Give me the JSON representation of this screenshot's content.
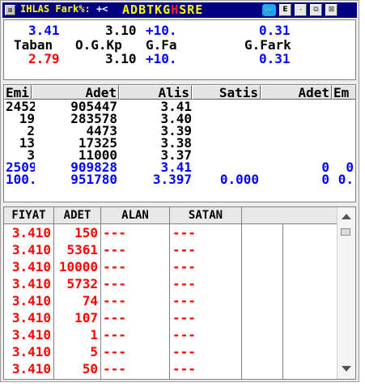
{
  "titlebar": {
    "system_icon": "close-box-icon",
    "name": "IHLAS Fark%:",
    "marker": "+<",
    "letters": [
      {
        "ch": "A",
        "color": "#ffff00"
      },
      {
        "ch": "D",
        "color": "#ffff00"
      },
      {
        "ch": "B",
        "color": "#ffff00"
      },
      {
        "ch": "T",
        "color": "#ffff00"
      },
      {
        "ch": "K",
        "color": "#ffff00"
      },
      {
        "ch": "G",
        "color": "#ffff00"
      },
      {
        "ch": "H",
        "color": "#ff2020"
      },
      {
        "ch": "S",
        "color": "#ffff00"
      },
      {
        "ch": "R",
        "color": "#ffff00"
      },
      {
        "ch": "E",
        "color": "#ffff00"
      }
    ],
    "twitter_icon": "twitter-bird-icon",
    "btn_e": "E",
    "btn_min": "-",
    "btn_max": "⧉",
    "btn_close": "⊠"
  },
  "price": {
    "row1": {
      "last": "3.41",
      "open": "3.10",
      "change": "+10.",
      "fark": "0.31"
    },
    "labels": {
      "taban": "Taban",
      "ogkp": "O.G.Kp",
      "gfa": "G.Fa",
      "gfark": "G.Fark"
    },
    "row2": {
      "taban": "2.79",
      "ogkp": "3.10",
      "gfa": "+10.",
      "gfark": "0.31"
    }
  },
  "depth": {
    "headers": [
      "Emi",
      "Adet",
      "Alis",
      "Satis",
      "Adet",
      "Em"
    ],
    "rows": [
      {
        "emir": "2452",
        "adet": "905447",
        "alis": "3.41"
      },
      {
        "emir": "19",
        "adet": "283578",
        "alis": "3.40"
      },
      {
        "emir": "2",
        "adet": "4473",
        "alis": "3.39"
      },
      {
        "emir": "13",
        "adet": "17325",
        "alis": "3.38"
      },
      {
        "emir": "3",
        "adet": "11000",
        "alis": "3.37"
      }
    ],
    "total_row": {
      "emir": "2509",
      "adet": "909828",
      "alis": "3.41",
      "sadet": "0",
      "semir": "0"
    },
    "avg_row": {
      "emir": "100.",
      "adet": "951780",
      "alis": "3.397",
      "satis": "0.000",
      "sadet": "0",
      "semir": "0."
    }
  },
  "trades": {
    "headers": [
      "FIYAT",
      "ADET",
      "ALAN",
      "SATAN"
    ],
    "rows": [
      {
        "fiyat": "3.410",
        "adet": "150",
        "alan": "---",
        "satan": "---"
      },
      {
        "fiyat": "3.410",
        "adet": "5361",
        "alan": "---",
        "satan": "---"
      },
      {
        "fiyat": "3.410",
        "adet": "10000",
        "alan": "---",
        "satan": "---"
      },
      {
        "fiyat": "3.410",
        "adet": "5732",
        "alan": "---",
        "satan": "---"
      },
      {
        "fiyat": "3.410",
        "adet": "74",
        "alan": "---",
        "satan": "---"
      },
      {
        "fiyat": "3.410",
        "adet": "107",
        "alan": "---",
        "satan": "---"
      },
      {
        "fiyat": "3.410",
        "adet": "1",
        "alan": "---",
        "satan": "---"
      },
      {
        "fiyat": "3.410",
        "adet": "5",
        "alan": "---",
        "satan": "---"
      },
      {
        "fiyat": "3.410",
        "adet": "50",
        "alan": "---",
        "satan": "---"
      }
    ]
  },
  "colors": {
    "blue": "#0000ff",
    "red": "#ff0000",
    "black": "#000000",
    "title_bg": "#000080",
    "title_text": "#ffff00"
  }
}
